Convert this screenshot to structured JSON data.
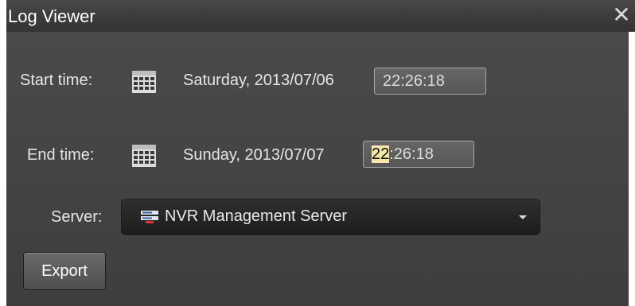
{
  "window": {
    "title": "Log Viewer",
    "close_label": "✕"
  },
  "start": {
    "label": "Start time:",
    "date": "Saturday, 2013/07/06",
    "time": "22:26:18"
  },
  "end": {
    "label": "End time:",
    "date": "Sunday, 2013/07/07",
    "time_hour": "22",
    "time_rest": ":26:18"
  },
  "server": {
    "label": "Server:",
    "selected": "NVR Management Server"
  },
  "export": {
    "label": "Export"
  },
  "icons": {
    "calendar": "calendar-icon",
    "server": "server-icon",
    "dropdown": "chevron-down-icon",
    "close": "close-icon"
  },
  "colors": {
    "background": "#444444",
    "text": "#e6e6e6",
    "highlight": "#f4e7a8"
  }
}
